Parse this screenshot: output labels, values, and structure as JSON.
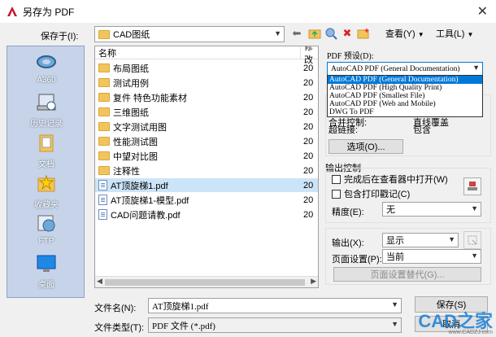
{
  "window": {
    "title": "另存为 PDF"
  },
  "save_in": {
    "label": "保存于(I):",
    "value": "CAD图纸"
  },
  "toolbar": {
    "view_label": "查看(Y)",
    "tools_label": "工具(L)"
  },
  "places": [
    {
      "label": "A360"
    },
    {
      "label": "历史记录"
    },
    {
      "label": "文档"
    },
    {
      "label": "收藏夹"
    },
    {
      "label": "FTP"
    },
    {
      "label": "桌面"
    }
  ],
  "filelist": {
    "col_name": "名称",
    "col_date": "修改",
    "items": [
      {
        "name": "布局图纸",
        "date": "20",
        "type": "folder"
      },
      {
        "name": "测试用例",
        "date": "20",
        "type": "folder"
      },
      {
        "name": "复件 特色功能素材",
        "date": "20",
        "type": "folder"
      },
      {
        "name": "三维图纸",
        "date": "20",
        "type": "folder"
      },
      {
        "name": "文字测试用图",
        "date": "20",
        "type": "folder"
      },
      {
        "name": "性能测试图",
        "date": "20",
        "type": "folder"
      },
      {
        "name": "中望对比图",
        "date": "20",
        "type": "folder"
      },
      {
        "name": "注释性",
        "date": "20",
        "type": "folder"
      },
      {
        "name": "AT顶旋梯1.pdf",
        "date": "20",
        "type": "pdf",
        "selected": true
      },
      {
        "name": "AT顶旋梯1-模型.pdf",
        "date": "20",
        "type": "pdf"
      },
      {
        "name": "CAD问题请教.pdf",
        "date": "20",
        "type": "pdf"
      }
    ]
  },
  "pdf_preset": {
    "label": "PDF 预设(D):",
    "value": "AutoCAD PDF (General Documentation)",
    "options": [
      "AutoCAD PDF (General Documentation)",
      "AutoCAD PDF (High Quality Print)",
      "AutoCAD PDF (Smallest File)",
      "AutoCAD PDF (Web and Mobile)",
      "DWG To PDF"
    ]
  },
  "preset_info": {
    "row1_label": "合并控制:",
    "row1_value": "直线覆盖",
    "row2_label": "超链接:",
    "row2_value": "包含",
    "options_button": "选项(O)..."
  },
  "output_control": {
    "title": "输出控制",
    "open_in_viewer": "完成后在查看器中打开(W)",
    "include_stamp": "包含打印戳记(C)",
    "precision_label": "精度(E):",
    "precision_value": "无"
  },
  "output": {
    "label": "输出(X):",
    "value": "显示",
    "page_setup_label": "页面设置(P):",
    "page_setup_value": "当前",
    "override_button": "页面设置替代(G)..."
  },
  "filename": {
    "label": "文件名(N):",
    "value": "AT顶旋梯1.pdf"
  },
  "filetype": {
    "label": "文件类型(T):",
    "value": "PDF 文件 (*.pdf)"
  },
  "buttons": {
    "save": "保存(S)",
    "cancel": "取消"
  },
  "watermark": {
    "text": "CAD之家",
    "url": "www.CADZJ.com"
  }
}
